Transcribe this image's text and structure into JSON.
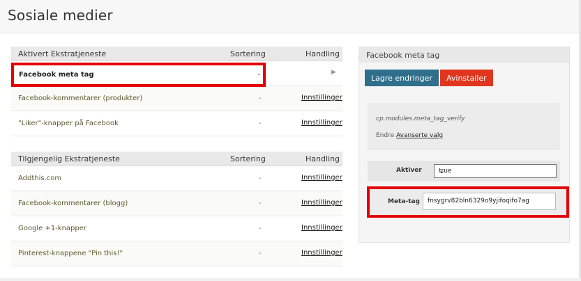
{
  "page": {
    "title": "Sosiale medier"
  },
  "active_table": {
    "headers": {
      "name": "Aktivert Ekstratjeneste",
      "sort": "Sortering",
      "action": "Handling"
    },
    "rows": [
      {
        "name": "Facebook meta tag",
        "sort": "-",
        "action": ""
      },
      {
        "name": "Facebook-kommentarer (produkter)",
        "sort": "-",
        "action": "Innstillinger"
      },
      {
        "name": "\"Liker\"-knapper på Facebook",
        "sort": "-",
        "action": "Innstillinger"
      }
    ]
  },
  "available_table": {
    "headers": {
      "name": "Tilgjengelig Ekstratjeneste",
      "sort": "Sortering",
      "action": "Handling"
    },
    "rows": [
      {
        "name": "Addthis.com",
        "sort": "-",
        "action": "Innstillinger"
      },
      {
        "name": "Facebook-kommentarer (blogg)",
        "sort": "-",
        "action": "Innstillinger"
      },
      {
        "name": "Google +1-knapper",
        "sort": "-",
        "action": "Innstillinger"
      },
      {
        "name": "Pinterest-knappene \"Pin this!\"",
        "sort": "-",
        "action": "Innstillinger"
      }
    ]
  },
  "settings_panel": {
    "title": "Facebook meta tag",
    "save_label": "Lagre endringer",
    "uninstall_label": "Avinstaller",
    "module_key": "cp.modules.meta_tag_verify",
    "change_prefix": "Endre",
    "advanced_link": "Avanserte valg",
    "activate_label": "Aktiver",
    "activate_value": "true",
    "meta_label": "Meta-tag",
    "meta_value": "fnsygrv82bln6329o9yjifoqifo7ag"
  },
  "colors": {
    "save": "#2f6f8c",
    "uninstall": "#e0361d",
    "highlight": "#e30000"
  }
}
